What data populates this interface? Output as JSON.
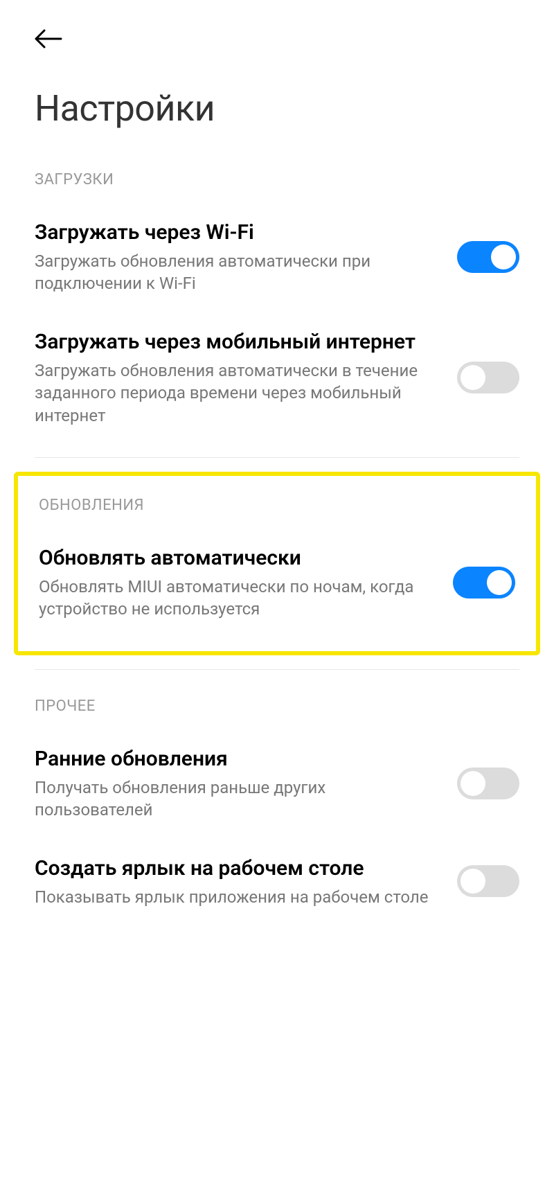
{
  "header": {
    "title": "Настройки"
  },
  "sections": {
    "downloads": {
      "label": "ЗАГРУЗКИ",
      "wifi": {
        "title": "Загружать через Wi-Fi",
        "desc": "Загружать обновления автоматически при подключении к Wi-Fi",
        "on": true
      },
      "mobile": {
        "title": "Загружать через мобильный интернет",
        "desc": "Загружать обновления автоматически в течение заданного периода времени через мобильный интернет",
        "on": false
      }
    },
    "updates": {
      "label": "ОБНОВЛЕНИЯ",
      "auto": {
        "title": "Обновлять автоматически",
        "desc": "Обновлять MIUI автоматически по ночам, когда устройство не используется",
        "on": true
      }
    },
    "other": {
      "label": "ПРОЧЕЕ",
      "early": {
        "title": "Ранние обновления",
        "desc": "Получать обновления раньше других пользователей",
        "on": false
      },
      "shortcut": {
        "title": "Создать ярлык на рабочем столе",
        "desc": "Показывать ярлык приложения на рабочем столе",
        "on": false
      }
    }
  },
  "colors": {
    "toggle_on": "#0b84ff",
    "toggle_off": "#dcdcdc",
    "highlight": "#f7e600"
  }
}
